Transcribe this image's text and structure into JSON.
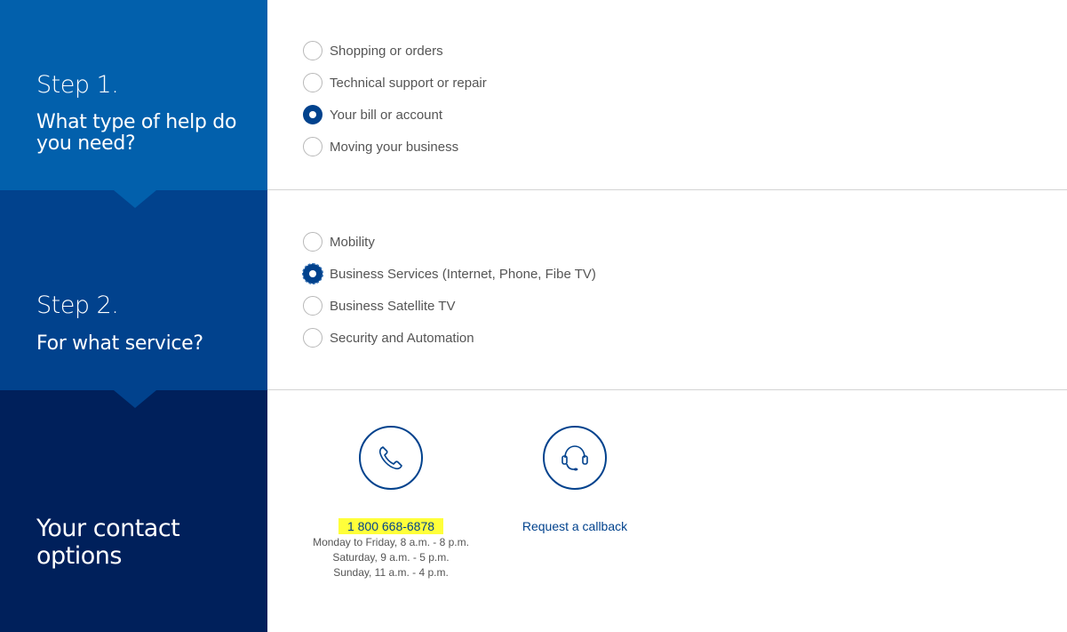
{
  "step1": {
    "title": "Step 1.",
    "subtitle": "What type of help do you need?",
    "options": [
      {
        "label": "Shopping or orders",
        "checked": false
      },
      {
        "label": "Technical support or repair",
        "checked": false
      },
      {
        "label": "Your bill or account",
        "checked": true
      },
      {
        "label": "Moving your business",
        "checked": false
      }
    ]
  },
  "step2": {
    "title": "Step 2.",
    "subtitle": "For what service?",
    "options": [
      {
        "label": "Mobility",
        "checked": false
      },
      {
        "label": "Business Services (Internet, Phone, Fibe TV)",
        "checked": true
      },
      {
        "label": "Business Satellite TV",
        "checked": false
      },
      {
        "label": "Security and Automation",
        "checked": false
      }
    ]
  },
  "contact": {
    "title": "Your contact options",
    "phone": {
      "icon": "phone-icon",
      "number": "1 800 668-6878",
      "hours": [
        "Monday to Friday, 8 a.m. - 8 p.m.",
        "Saturday, 9 a.m. - 5 p.m.",
        "Sunday, 11 a.m. - 4 p.m."
      ],
      "highlight_color": "#ffff3a"
    },
    "callback": {
      "icon": "headset-icon",
      "label": "Request a callback"
    }
  },
  "colors": {
    "step1_bg": "#0260ac",
    "step2_bg": "#01428d",
    "contact_bg": "#00205b",
    "accent": "#01428d"
  }
}
